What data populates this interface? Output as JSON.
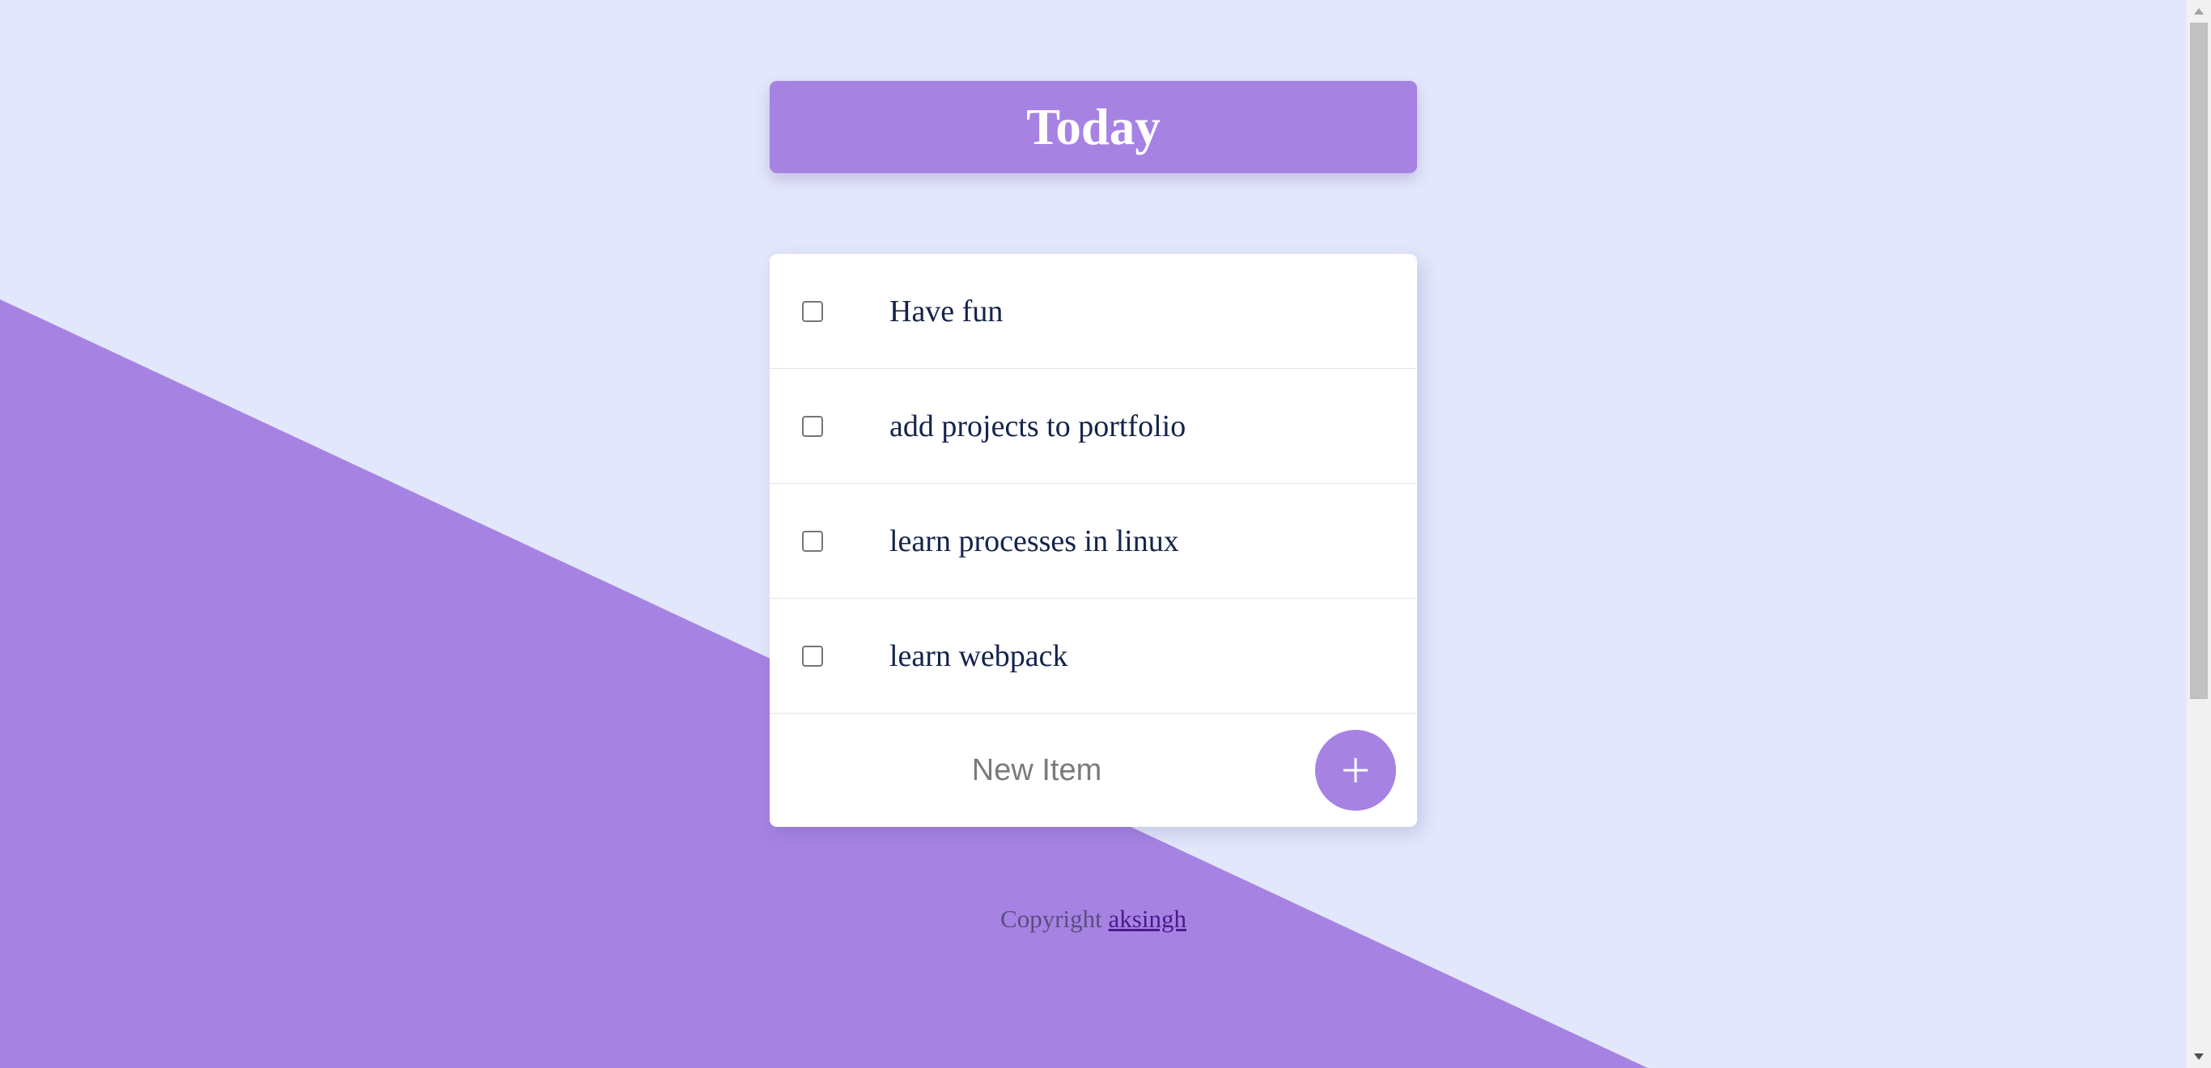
{
  "colors": {
    "background": "#e3e7fb",
    "accent": "#a683e3",
    "item_text": "#14234a"
  },
  "header": {
    "title": "Today"
  },
  "todo": {
    "items": [
      {
        "label": "Have fun",
        "checked": false
      },
      {
        "label": "add projects to portfolio",
        "checked": false
      },
      {
        "label": "learn processes in linux",
        "checked": false
      },
      {
        "label": "learn webpack",
        "checked": false
      }
    ],
    "new_item_placeholder": "New Item",
    "new_item_value": "",
    "add_button_icon": "plus-icon"
  },
  "footer": {
    "copyright_text": "Copyright",
    "author_link": "aksingh"
  },
  "scrollbar": {
    "up_icon": "scroll-up-arrow-icon",
    "down_icon": "scroll-down-arrow-icon"
  }
}
